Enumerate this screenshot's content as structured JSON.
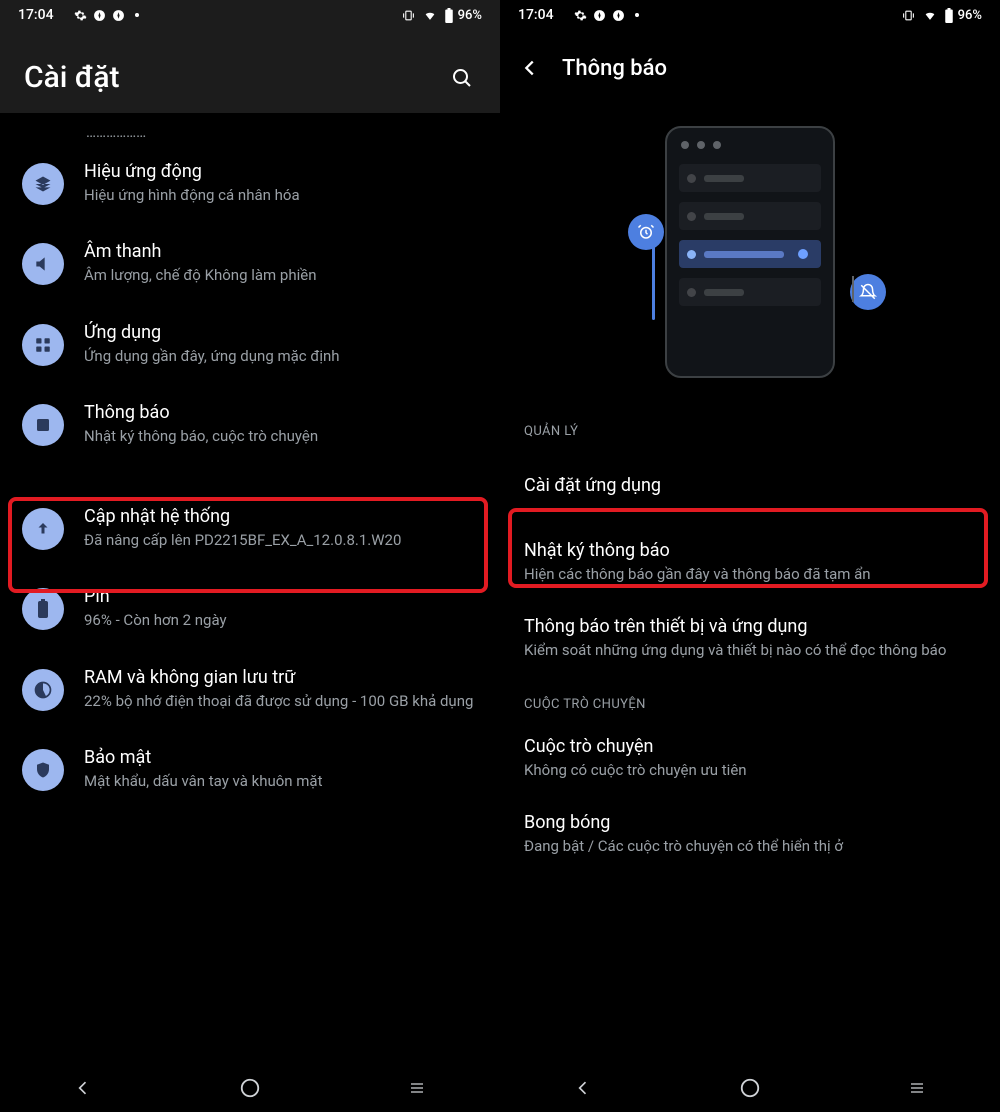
{
  "status": {
    "time": "17:04",
    "battery": "96%"
  },
  "left": {
    "title": "Cài đặt",
    "truncated_top": "………………",
    "items": [
      {
        "title": "Hiệu ứng động",
        "subtitle": "Hiệu ứng hình động cá nhân hóa"
      },
      {
        "title": "Âm thanh",
        "subtitle": "Âm lượng, chế độ Không làm phiền"
      },
      {
        "title": "Ứng dụng",
        "subtitle": "Ứng dụng gần đây, ứng dụng mặc định"
      },
      {
        "title": "Thông báo",
        "subtitle": "Nhật ký thông báo, cuộc trò chuyện"
      },
      {
        "title": "Cập nhật hệ thống",
        "subtitle": "Đã nâng cấp lên PD2215BF_EX_A_12.0.8.1.W20"
      },
      {
        "title": "Pin",
        "subtitle": "96% - Còn hơn 2 ngày"
      },
      {
        "title": "RAM và không gian lưu trữ",
        "subtitle": "22% bộ nhớ điện thoại đã được sử dụng - 100 GB khả dụng"
      },
      {
        "title": "Bảo mật",
        "subtitle": "Mật khẩu, dấu vân tay và khuôn mặt"
      }
    ]
  },
  "right": {
    "title": "Thông báo",
    "sections": [
      {
        "label": "QUẢN LÝ",
        "items": [
          {
            "title": "Cài đặt ứng dụng"
          },
          {
            "title": "Nhật ký thông báo",
            "subtitle": "Hiện các thông báo gần đây và thông báo đã tạm ẩn"
          },
          {
            "title": "Thông báo trên thiết bị và ứng dụng",
            "subtitle": "Kiểm soát những ứng dụng và thiết bị nào có thể đọc thông báo"
          }
        ]
      },
      {
        "label": "CUỘC TRÒ CHUYỆN",
        "items": [
          {
            "title": "Cuộc trò chuyện",
            "subtitle": "Không có cuộc trò chuyện ưu tiên"
          },
          {
            "title": "Bong bóng",
            "subtitle": "Đang bật / Các cuộc trò chuyện có thể hiển thị ở"
          }
        ]
      }
    ]
  }
}
